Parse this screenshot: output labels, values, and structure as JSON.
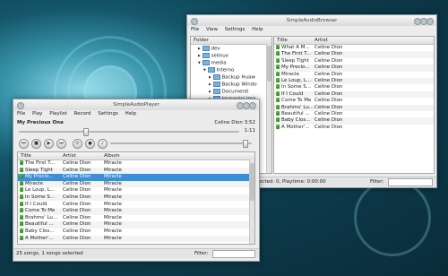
{
  "browser": {
    "title": "SimpleAudioBrowser",
    "menu": [
      "File",
      "View",
      "Settings",
      "Help"
    ],
    "folder_header": "Folder",
    "tree": [
      {
        "label": "dev",
        "expander": "▸"
      },
      {
        "label": "selinux",
        "expander": "▸"
      },
      {
        "label": "media",
        "expander": "▾"
      },
      {
        "label": "Interno",
        "expander": "▾"
      },
      {
        "label": "Backup Huaw",
        "expander": "▸"
      },
      {
        "label": "Backup Windo",
        "expander": "▸"
      },
      {
        "label": "Documenti",
        "expander": "▸"
      },
      {
        "label": "Immagini Ima",
        "expander": "▸"
      }
    ],
    "columns": [
      "Title",
      "Artist"
    ],
    "tracks": [
      [
        "What A M...",
        "Celine Dion"
      ],
      [
        "The First T...",
        "Celine Dion"
      ],
      [
        "Sleep Tight",
        "Celine Dion"
      ],
      [
        "My Precio...",
        "Celine Dion"
      ],
      [
        "Miracle",
        "Celine Dion"
      ],
      [
        "Le Loup, L...",
        "Celine Dion"
      ],
      [
        "In Some S...",
        "Celine Dion"
      ],
      [
        "If I Could",
        "Celine Dion"
      ],
      [
        "Come To Me",
        "Celine Dion"
      ],
      [
        "Brahms' Lu...",
        "Celine Dion"
      ],
      [
        "Beautiful ...",
        "Celine Dion"
      ],
      [
        "Baby Clos...",
        "Celine Dion"
      ],
      [
        "A Mother'...",
        "Celine Dion"
      ]
    ],
    "status": "elected: 0, Playtime: 0:00:00",
    "filter_label": "Filter:",
    "filter_value": ""
  },
  "player": {
    "title": "SimpleAudioPlayer",
    "menu": [
      "File",
      "Play",
      "Playlist",
      "Record",
      "Settings",
      "Help"
    ],
    "now_playing": "My Precious One",
    "now_artist_time": "Celine Dion 3:52",
    "elapsed": "1:11",
    "progress": 0.3,
    "volume": 0.95,
    "controls": {
      "prev": "⏮",
      "stop": "■",
      "play": "▶",
      "next": "⏭",
      "repeat": "⟳",
      "record": "●"
    },
    "columns": [
      "Title",
      "Artist",
      "Album"
    ],
    "tracks": [
      [
        "The First T...",
        "Celine Dion",
        "Miracle"
      ],
      [
        "Sleep Tight",
        "Celine Dion",
        "Miracle"
      ],
      [
        "My Precio...",
        "Celine Dion",
        "Miracle"
      ],
      [
        "Miracle",
        "Celine Dion",
        "Miracle"
      ],
      [
        "Le Loup, L...",
        "Celine Dion",
        "Miracle"
      ],
      [
        "In Some S...",
        "Celine Dion",
        "Miracle"
      ],
      [
        "If I Could",
        "Celine Dion",
        "Miracle"
      ],
      [
        "Come To Me",
        "Celine Dion",
        "Miracle"
      ],
      [
        "Brahms' Lu...",
        "Celine Dion",
        "Miracle"
      ],
      [
        "Beautiful ...",
        "Celine Dion",
        "Miracle"
      ],
      [
        "Baby Clos...",
        "Celine Dion",
        "Miracle"
      ],
      [
        "A Mother'...",
        "Celine Dion",
        "Miracle"
      ]
    ],
    "selected_index": 2,
    "status": "25 songs, 1 songs selected",
    "filter_label": "Filter:",
    "filter_value": ""
  }
}
